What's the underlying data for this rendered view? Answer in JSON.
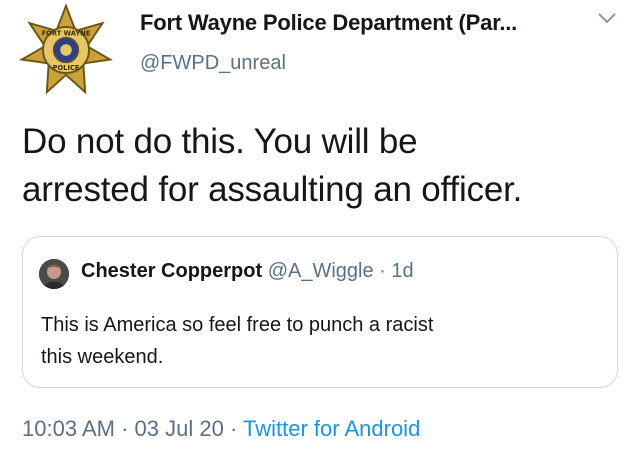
{
  "author": {
    "display_name": "Fort Wayne Police Department (Par...",
    "handle": "@FWPD_unreal",
    "badge_text_top": "FORT WAYNE",
    "badge_text_bottom": "POLICE"
  },
  "tweet": {
    "lines": [
      "Do not do this. You will be",
      "arrested for assaulting an officer."
    ]
  },
  "quoted": {
    "name": "Chester Copperpot",
    "handle": "@A_Wiggle",
    "dot": "·",
    "time": "1d",
    "lines": [
      "This is America so feel free to punch a racist",
      "this weekend."
    ]
  },
  "meta": {
    "time": "10:03 AM",
    "sep1": "·",
    "date": "03 Jul 20",
    "sep2": "·",
    "source": "Twitter for Android"
  },
  "colors": {
    "text": "#14171a",
    "secondary": "#5b7083",
    "link": "#1b95e0",
    "border": "#cfd9de",
    "badge_gold": "#c9a23a"
  },
  "icons": [
    "police-badge-icon",
    "chevron-down-icon",
    "avatar-icon"
  ]
}
